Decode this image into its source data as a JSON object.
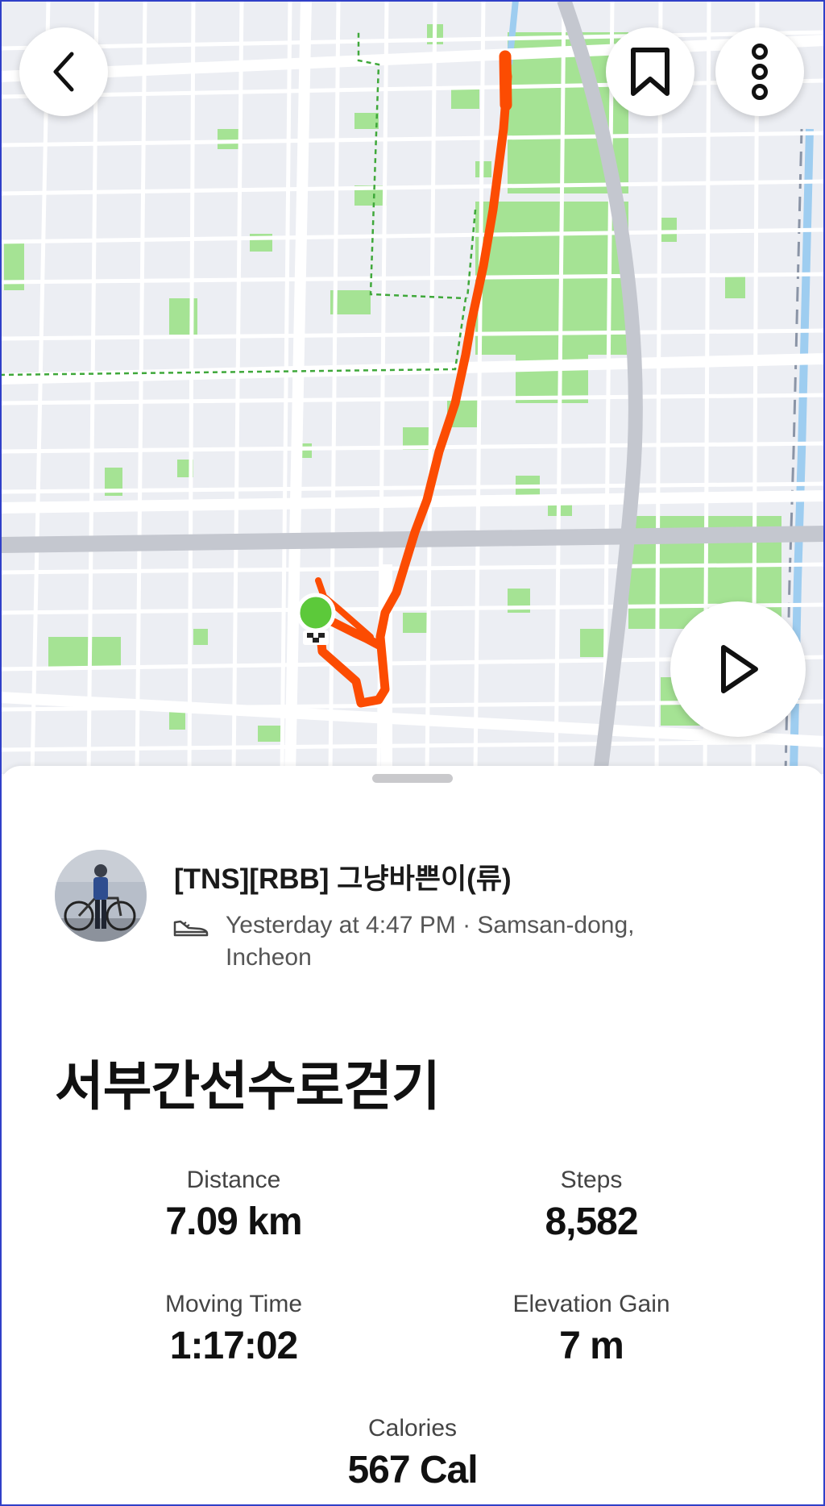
{
  "map": {
    "route_color": "#fc4c02",
    "start_color": "#5cc93a",
    "park_color": "#9ee08e",
    "back_icon": "chevron-left-icon",
    "bookmark_icon": "bookmark-icon",
    "more_icon": "more-vertical-icon",
    "play_icon": "play-icon"
  },
  "activity": {
    "athlete_name": "[TNS][RBB] 그냥바쁜이(류)",
    "sport_icon": "shoe-icon",
    "meta": "Yesterday at 4:47 PM · Samsan-dong, Incheon",
    "title": "서부간선수로걷기"
  },
  "stats": {
    "distance": {
      "label": "Distance",
      "value": "7.09 km"
    },
    "steps": {
      "label": "Steps",
      "value": "8,582"
    },
    "moving_time": {
      "label": "Moving Time",
      "value": "1:17:02"
    },
    "elevation_gain": {
      "label": "Elevation Gain",
      "value": "7 m"
    },
    "calories": {
      "label": "Calories",
      "value": "567 Cal"
    }
  }
}
